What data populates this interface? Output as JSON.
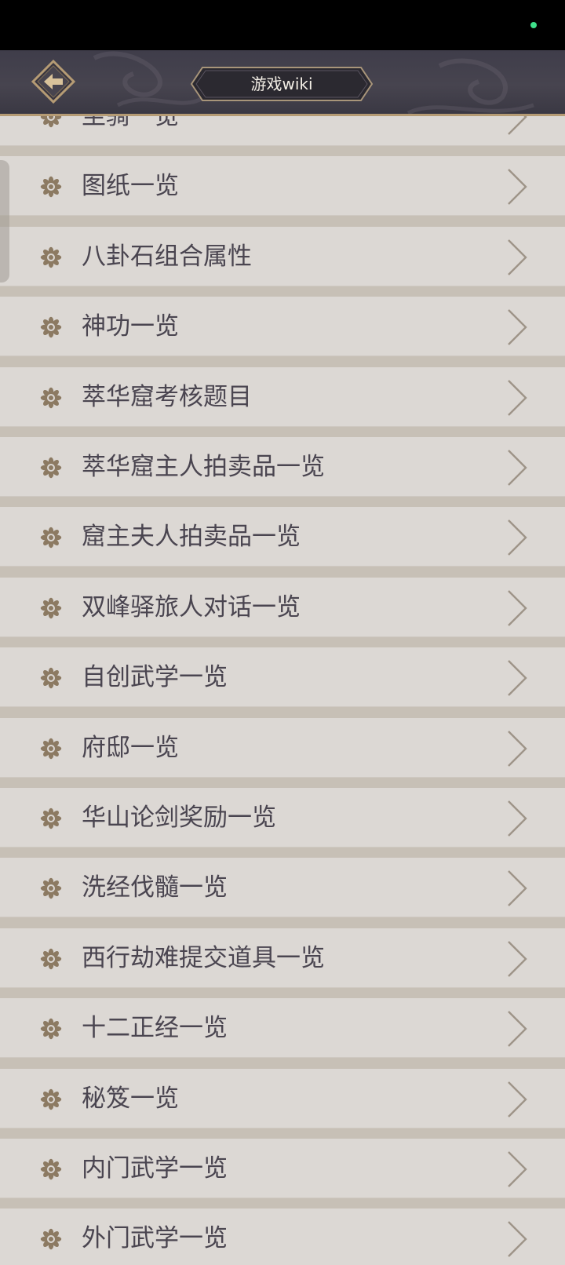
{
  "header": {
    "title": "游戏wiki"
  },
  "icons": {
    "back": "back-arrow-icon",
    "item": "flower-emblem-icon",
    "chevron": "chevron-right-icon"
  },
  "colors": {
    "header_bg": "#424049",
    "header_border": "#b59b74",
    "row_bg": "#dcd8d4",
    "gap_bg": "#c7c0b6",
    "text": "#4a4550",
    "icon": "#8c7a62",
    "status_dot": "#3ee08a"
  },
  "list": {
    "items": [
      {
        "label": "坐骑一览"
      },
      {
        "label": "图纸一览"
      },
      {
        "label": "八卦石组合属性"
      },
      {
        "label": "神功一览"
      },
      {
        "label": "萃华窟考核题目"
      },
      {
        "label": "萃华窟主人拍卖品一览"
      },
      {
        "label": "窟主夫人拍卖品一览"
      },
      {
        "label": "双峰驿旅人对话一览"
      },
      {
        "label": "自创武学一览"
      },
      {
        "label": "府邸一览"
      },
      {
        "label": "华山论剑奖励一览"
      },
      {
        "label": "洗经伐髓一览"
      },
      {
        "label": "西行劫难提交道具一览"
      },
      {
        "label": "十二正经一览"
      },
      {
        "label": "秘笈一览"
      },
      {
        "label": "内门武学一览"
      },
      {
        "label": "外门武学一览"
      }
    ]
  }
}
